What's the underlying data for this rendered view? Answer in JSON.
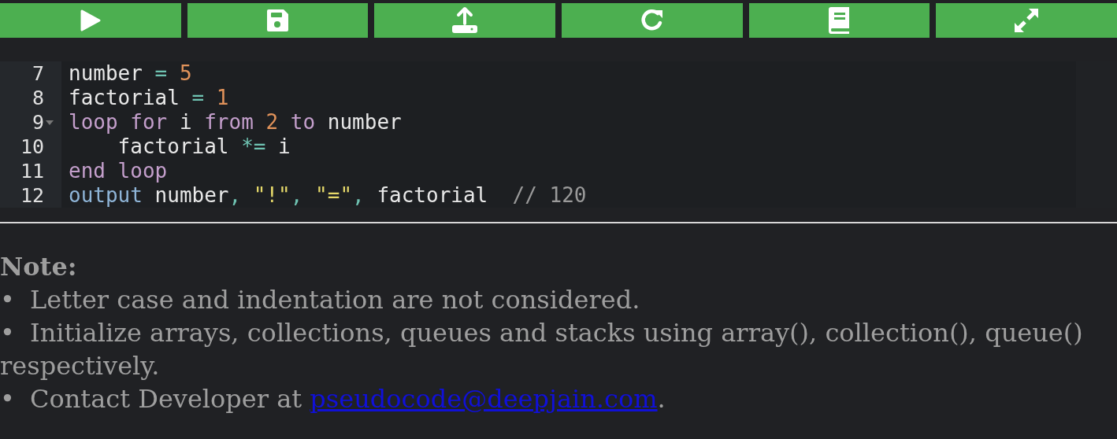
{
  "editor": {
    "lines": [
      {
        "number": "7",
        "foldable": false,
        "tokens": [
          {
            "kind": "ident",
            "text": "number "
          },
          {
            "kind": "operator",
            "text": "= "
          },
          {
            "kind": "number",
            "text": "5"
          }
        ]
      },
      {
        "number": "8",
        "foldable": false,
        "tokens": [
          {
            "kind": "ident",
            "text": "factorial "
          },
          {
            "kind": "operator",
            "text": "= "
          },
          {
            "kind": "number",
            "text": "1"
          }
        ]
      },
      {
        "number": "9",
        "foldable": true,
        "tokens": [
          {
            "kind": "keyword",
            "text": "loop for"
          },
          {
            "kind": "ident",
            "text": " i "
          },
          {
            "kind": "keyword",
            "text": "from "
          },
          {
            "kind": "number",
            "text": "2 "
          },
          {
            "kind": "keyword",
            "text": "to"
          },
          {
            "kind": "ident",
            "text": " number"
          }
        ]
      },
      {
        "number": "10",
        "foldable": false,
        "tokens": [
          {
            "kind": "ident",
            "text": "    factorial "
          },
          {
            "kind": "operator",
            "text": "*="
          },
          {
            "kind": "ident",
            "text": " i"
          }
        ]
      },
      {
        "number": "11",
        "foldable": false,
        "tokens": [
          {
            "kind": "keyword",
            "text": "end loop"
          }
        ]
      },
      {
        "number": "12",
        "foldable": false,
        "tokens": [
          {
            "kind": "builtin",
            "text": "output"
          },
          {
            "kind": "ident",
            "text": " number"
          },
          {
            "kind": "operator",
            "text": ", "
          },
          {
            "kind": "string",
            "text": "\"!\""
          },
          {
            "kind": "operator",
            "text": ", "
          },
          {
            "kind": "string",
            "text": "\"=\""
          },
          {
            "kind": "operator",
            "text": ", "
          },
          {
            "kind": "ident",
            "text": "factorial  "
          },
          {
            "kind": "comment",
            "text": "// 120"
          }
        ]
      }
    ]
  },
  "note": {
    "title": "Note:",
    "items": [
      {
        "bullet": "•",
        "text": "Letter case and indentation are not considered."
      },
      {
        "bullet": "•",
        "text": "Initialize arrays, collections, queues and stacks using array(), collection(), queue()",
        "continuation": "respectively."
      },
      {
        "bullet": "•",
        "text": "Contact Developer at ",
        "link": "pseudocode@deepjain.com",
        "after": "."
      }
    ]
  }
}
